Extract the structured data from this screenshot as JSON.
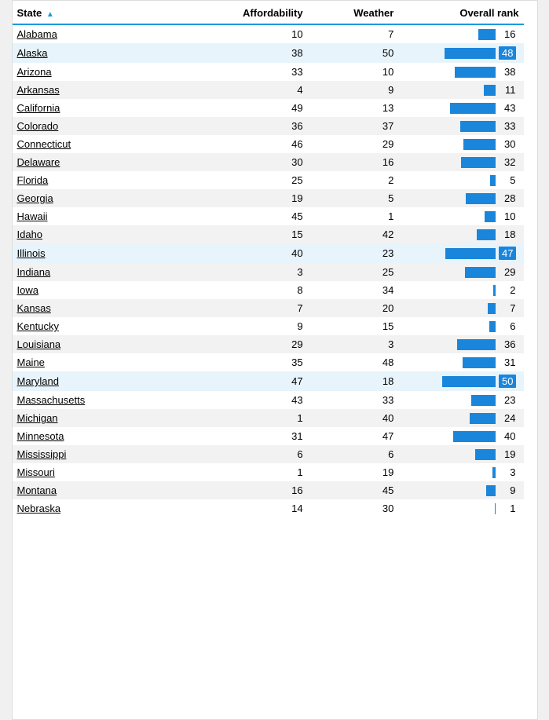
{
  "header": {
    "col_state": "State",
    "col_affordability": "Affordability",
    "col_weather": "Weather",
    "col_overall": "Overall rank"
  },
  "rows": [
    {
      "state": "Alabama",
      "affordability": 10,
      "weather": 7,
      "overall": 16,
      "highlighted": false
    },
    {
      "state": "Alaska",
      "affordability": 38,
      "weather": 50,
      "overall": 48,
      "highlighted": true
    },
    {
      "state": "Arizona",
      "affordability": 33,
      "weather": 10,
      "overall": 38,
      "highlighted": false
    },
    {
      "state": "Arkansas",
      "affordability": 4,
      "weather": 9,
      "overall": 11,
      "highlighted": false
    },
    {
      "state": "California",
      "affordability": 49,
      "weather": 13,
      "overall": 43,
      "highlighted": false
    },
    {
      "state": "Colorado",
      "affordability": 36,
      "weather": 37,
      "overall": 33,
      "highlighted": false
    },
    {
      "state": "Connecticut",
      "affordability": 46,
      "weather": 29,
      "overall": 30,
      "highlighted": false
    },
    {
      "state": "Delaware",
      "affordability": 30,
      "weather": 16,
      "overall": 32,
      "highlighted": false
    },
    {
      "state": "Florida",
      "affordability": 25,
      "weather": 2,
      "overall": 5,
      "highlighted": false
    },
    {
      "state": "Georgia",
      "affordability": 19,
      "weather": 5,
      "overall": 28,
      "highlighted": false
    },
    {
      "state": "Hawaii",
      "affordability": 45,
      "weather": 1,
      "overall": 10,
      "highlighted": false
    },
    {
      "state": "Idaho",
      "affordability": 15,
      "weather": 42,
      "overall": 18,
      "highlighted": false
    },
    {
      "state": "Illinois",
      "affordability": 40,
      "weather": 23,
      "overall": 47,
      "highlighted": true
    },
    {
      "state": "Indiana",
      "affordability": 3,
      "weather": 25,
      "overall": 29,
      "highlighted": false
    },
    {
      "state": "Iowa",
      "affordability": 8,
      "weather": 34,
      "overall": 2,
      "highlighted": false
    },
    {
      "state": "Kansas",
      "affordability": 7,
      "weather": 20,
      "overall": 7,
      "highlighted": false
    },
    {
      "state": "Kentucky",
      "affordability": 9,
      "weather": 15,
      "overall": 6,
      "highlighted": false
    },
    {
      "state": "Louisiana",
      "affordability": 29,
      "weather": 3,
      "overall": 36,
      "highlighted": false
    },
    {
      "state": "Maine",
      "affordability": 35,
      "weather": 48,
      "overall": 31,
      "highlighted": false
    },
    {
      "state": "Maryland",
      "affordability": 47,
      "weather": 18,
      "overall": 50,
      "highlighted": true
    },
    {
      "state": "Massachusetts",
      "affordability": 43,
      "weather": 33,
      "overall": 23,
      "highlighted": false
    },
    {
      "state": "Michigan",
      "affordability": 1,
      "weather": 40,
      "overall": 24,
      "highlighted": false
    },
    {
      "state": "Minnesota",
      "affordability": 31,
      "weather": 47,
      "overall": 40,
      "highlighted": false
    },
    {
      "state": "Mississippi",
      "affordability": 6,
      "weather": 6,
      "overall": 19,
      "highlighted": false
    },
    {
      "state": "Missouri",
      "affordability": 1,
      "weather": 19,
      "overall": 3,
      "highlighted": false
    },
    {
      "state": "Montana",
      "affordability": 16,
      "weather": 45,
      "overall": 9,
      "highlighted": false
    },
    {
      "state": "Nebraska",
      "affordability": 14,
      "weather": 30,
      "overall": 1,
      "highlighted": false
    }
  ],
  "max_rank": 50
}
